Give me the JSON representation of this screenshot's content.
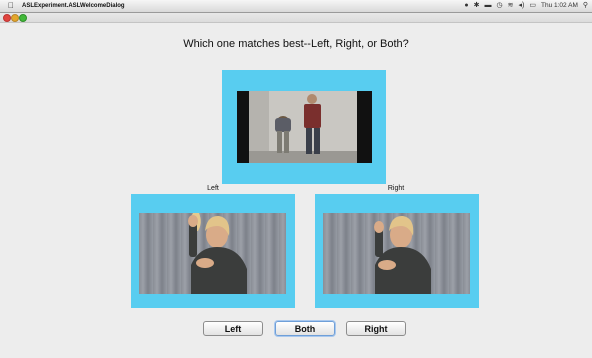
{
  "menubar": {
    "app_name": "ASLExperiment.ASLWelcomeDialog",
    "clock": "Thu 1:02 AM",
    "icons": [
      "apple-icon",
      "wifi-icon",
      "volume-icon",
      "bluetooth-icon",
      "time-machine-icon",
      "battery-icon",
      "spotlight-icon"
    ]
  },
  "dialog": {
    "question": "Which one matches best--Left, Right, or Both?",
    "left_label": "Left",
    "right_label": "Right",
    "buttons": {
      "left": "Left",
      "both": "Both",
      "right": "Right"
    }
  },
  "colors": {
    "frame": "#58cdf0",
    "background": "#ededed"
  }
}
